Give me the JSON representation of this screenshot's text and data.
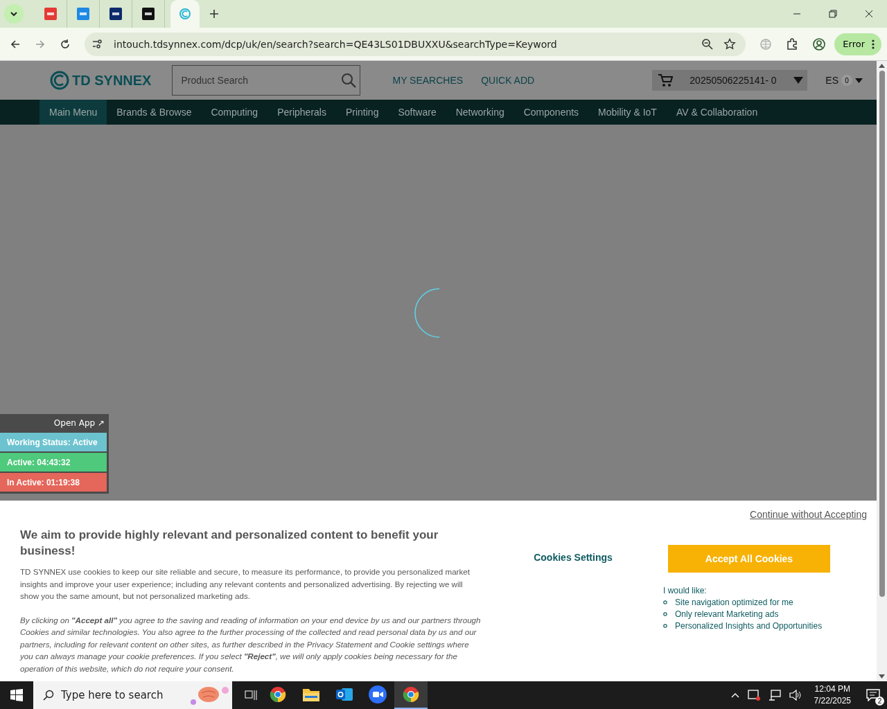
{
  "browser": {
    "tabs": [
      {
        "kind": "red",
        "selected": false
      },
      {
        "kind": "blue",
        "selected": false
      },
      {
        "kind": "navy",
        "selected": false
      },
      {
        "kind": "black",
        "selected": false
      },
      {
        "kind": "synnex",
        "selected": true
      }
    ],
    "url": "intouch.tdsynnex.com/dcp/uk/en/search?search=QE43LS01DBUXXU&searchType=Keyword",
    "profile_button": "Error"
  },
  "header": {
    "logo": "TD SYNNEX",
    "search": {
      "placeholder": "Product Search"
    },
    "links": [
      "MY SEARCHES",
      "QUICK ADD"
    ],
    "cart": "20250506225141- 0",
    "language": "ES",
    "language_count": "0"
  },
  "nav": [
    {
      "label": "Main Menu",
      "selected": true
    },
    {
      "label": "Brands & Browse",
      "selected": false
    },
    {
      "label": "Computing",
      "selected": false
    },
    {
      "label": "Peripherals",
      "selected": false
    },
    {
      "label": "Printing",
      "selected": false
    },
    {
      "label": "Software",
      "selected": false
    },
    {
      "label": "Networking",
      "selected": false
    },
    {
      "label": "Components",
      "selected": false
    },
    {
      "label": "Mobility & IoT",
      "selected": false
    },
    {
      "label": "AV & Collaboration",
      "selected": false
    }
  ],
  "cookie_banner": {
    "continue_link": "Continue without Accepting",
    "heading": "We aim to provide highly relevant and personalized content to benefit your business!",
    "paragraph": "TD SYNNEX use cookies to keep our site reliable and secure, to measure its performance, to provide you personalized market insights and improve your user experience; including any relevant contents and personalized advertising. By rejecting we will show you the same amount, but not personalized marketing ads.",
    "consent_text": "By clicking on **\"Accept all\"** you agree to the saving and reading of information on your end device by us and our partners through Cookies and similar technologies. You also agree to the further processing of the collected and read personal data by us and our partners, including for relevant content on other sites, as further described in the Privacy Statement and Cookie settings where you can always manage your cookie preferences. If you select **\"Reject\"**, we will only apply cookies being necessary for the operation of this website, which do not require your consent.",
    "settings_button": "Cookies Settings",
    "accept_button": "Accept All Cookies",
    "would_like": "I would like:",
    "options": [
      "Site navigation optimized for me",
      "Only relevant Marketing ads",
      "Personalized Insights and Opportunities"
    ]
  },
  "status_widget": {
    "open_app": "Open App ↗",
    "rows": [
      {
        "text": "Working Status: Active",
        "color": "#6cc3cf"
      },
      {
        "text": "Active: 04:43:32",
        "color": "#4fc97c"
      },
      {
        "text": "In Active: 01:19:38",
        "color": "#e5665a"
      }
    ]
  },
  "taskbar": {
    "search": {
      "placeholder": "Type here to search"
    },
    "apps": [
      {
        "kind": "chrome",
        "selected": false
      },
      {
        "kind": "folder",
        "selected": false
      },
      {
        "kind": "outlook",
        "selected": false
      },
      {
        "kind": "zoom",
        "selected": false
      },
      {
        "kind": "chrome",
        "selected": true
      }
    ],
    "time": "12:04 PM",
    "date": "7/22/2025",
    "notifications": "2"
  }
}
